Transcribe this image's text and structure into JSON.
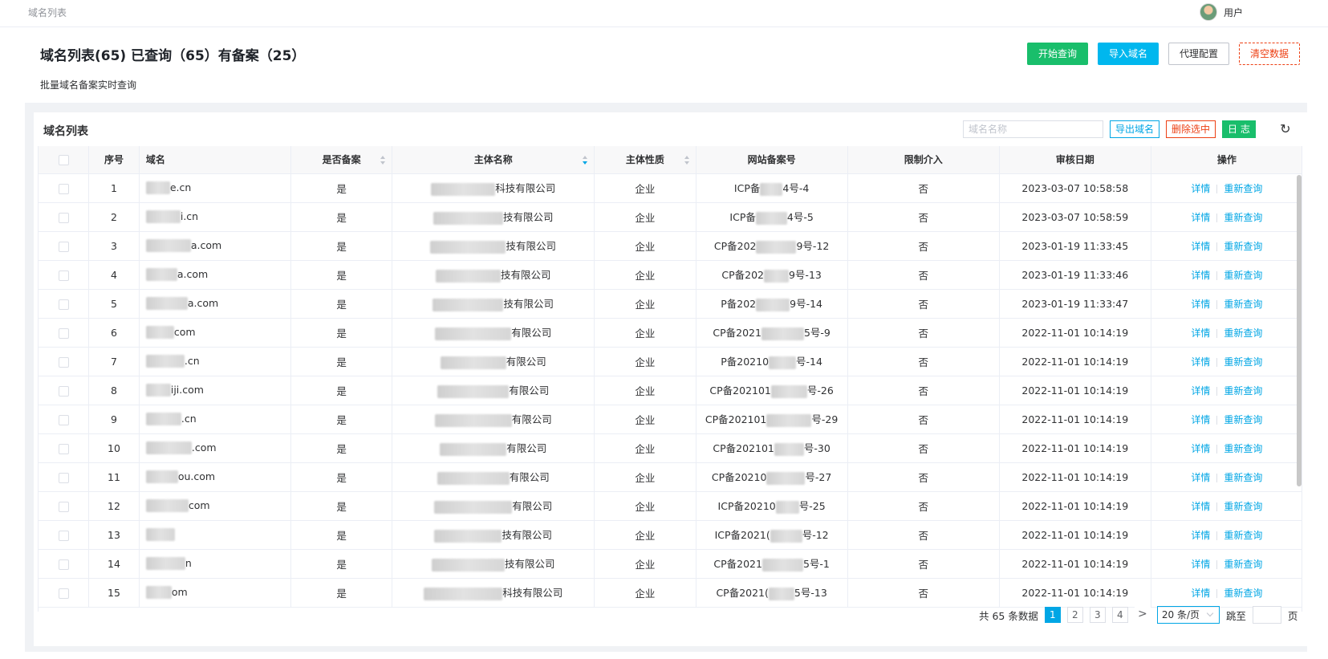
{
  "breadcrumb": "域名列表",
  "user": {
    "name": "用户"
  },
  "header": {
    "title": "域名列表(65) 已查询（65）有备案（25）",
    "subtitle": "批量域名备案实时查询",
    "buttons": {
      "start": "开始查询",
      "import": "导入域名",
      "proxy": "代理配置",
      "clear": "清空数据"
    }
  },
  "panel": {
    "title": "域名列表",
    "search_placeholder": "域名名称",
    "export": "导出域名",
    "delete_selected": "删除选中",
    "log": "日 志"
  },
  "table": {
    "columns": [
      "序号",
      "域名",
      "是否备案",
      "主体名称",
      "主体性质",
      "网站备案号",
      "限制介入",
      "审核日期",
      "操作"
    ],
    "rows": [
      {
        "no": "1",
        "domain": "e.cn",
        "filed": "是",
        "entity": "科技有限公司",
        "nature": "企业",
        "icp_pre": "ICP备",
        "icp_suf": "4号-4",
        "restrict": "否",
        "date": "2023-03-07 10:58:58"
      },
      {
        "no": "2",
        "domain": "i.cn",
        "filed": "是",
        "entity": "技有限公司",
        "nature": "企业",
        "icp_pre": "ICP备",
        "icp_suf": "4号-5",
        "restrict": "否",
        "date": "2023-03-07 10:58:59"
      },
      {
        "no": "3",
        "domain": "a.com",
        "filed": "是",
        "entity": "技有限公司",
        "nature": "企业",
        "icp_pre": "CP备202",
        "icp_suf": "9号-12",
        "restrict": "否",
        "date": "2023-01-19 11:33:45"
      },
      {
        "no": "4",
        "domain": "a.com",
        "filed": "是",
        "entity": "技有限公司",
        "nature": "企业",
        "icp_pre": "CP备202",
        "icp_suf": "9号-13",
        "restrict": "否",
        "date": "2023-01-19 11:33:46"
      },
      {
        "no": "5",
        "domain": "a.com",
        "filed": "是",
        "entity": "技有限公司",
        "nature": "企业",
        "icp_pre": "P备202",
        "icp_suf": "9号-14",
        "restrict": "否",
        "date": "2023-01-19 11:33:47"
      },
      {
        "no": "6",
        "domain": "com",
        "filed": "是",
        "entity": "有限公司",
        "nature": "企业",
        "icp_pre": "CP备2021",
        "icp_suf": "5号-9",
        "restrict": "否",
        "date": "2022-11-01 10:14:19"
      },
      {
        "no": "7",
        "domain": ".cn",
        "filed": "是",
        "entity": "有限公司",
        "nature": "企业",
        "icp_pre": "P备20210",
        "icp_suf": "号-14",
        "restrict": "否",
        "date": "2022-11-01 10:14:19"
      },
      {
        "no": "8",
        "domain": "iji.com",
        "filed": "是",
        "entity": "有限公司",
        "nature": "企业",
        "icp_pre": "CP备202101",
        "icp_suf": "号-26",
        "restrict": "否",
        "date": "2022-11-01 10:14:19"
      },
      {
        "no": "9",
        "domain": ".cn",
        "filed": "是",
        "entity": "有限公司",
        "nature": "企业",
        "icp_pre": "CP备202101",
        "icp_suf": "号-29",
        "restrict": "否",
        "date": "2022-11-01 10:14:19"
      },
      {
        "no": "10",
        "domain": ".com",
        "filed": "是",
        "entity": "有限公司",
        "nature": "企业",
        "icp_pre": "CP备202101",
        "icp_suf": "号-30",
        "restrict": "否",
        "date": "2022-11-01 10:14:19"
      },
      {
        "no": "11",
        "domain": "ou.com",
        "filed": "是",
        "entity": "有限公司",
        "nature": "企业",
        "icp_pre": "CP备20210",
        "icp_suf": "号-27",
        "restrict": "否",
        "date": "2022-11-01 10:14:19"
      },
      {
        "no": "12",
        "domain": "com",
        "filed": "是",
        "entity": "有限公司",
        "nature": "企业",
        "icp_pre": "ICP备20210",
        "icp_suf": "号-25",
        "restrict": "否",
        "date": "2022-11-01 10:14:19"
      },
      {
        "no": "13",
        "domain": "",
        "filed": "是",
        "entity": "技有限公司",
        "nature": "企业",
        "icp_pre": "ICP备2021(",
        "icp_suf": "号-12",
        "restrict": "否",
        "date": "2022-11-01 10:14:19"
      },
      {
        "no": "14",
        "domain": "n",
        "filed": "是",
        "entity": "技有限公司",
        "nature": "企业",
        "icp_pre": "CP备2021",
        "icp_suf": "5号-1",
        "restrict": "否",
        "date": "2022-11-01 10:14:19"
      },
      {
        "no": "15",
        "domain": "om",
        "filed": "是",
        "entity": "科技有限公司",
        "nature": "企业",
        "icp_pre": "CP备2021(",
        "icp_suf": "5号-13",
        "restrict": "否",
        "date": "2022-11-01 10:14:19"
      }
    ],
    "op_detail": "详情",
    "op_requery": "重新查询"
  },
  "pagination": {
    "total_text": "共 65 条数据",
    "pages": [
      "1",
      "2",
      "3",
      "4"
    ],
    "current": "1",
    "next": ">",
    "page_size": "20 条/页",
    "jump_label": "跳至",
    "page_suffix": "页"
  },
  "colors": {
    "primary": "#00a6e5",
    "green": "#19be6b",
    "danger": "#ed4014"
  }
}
